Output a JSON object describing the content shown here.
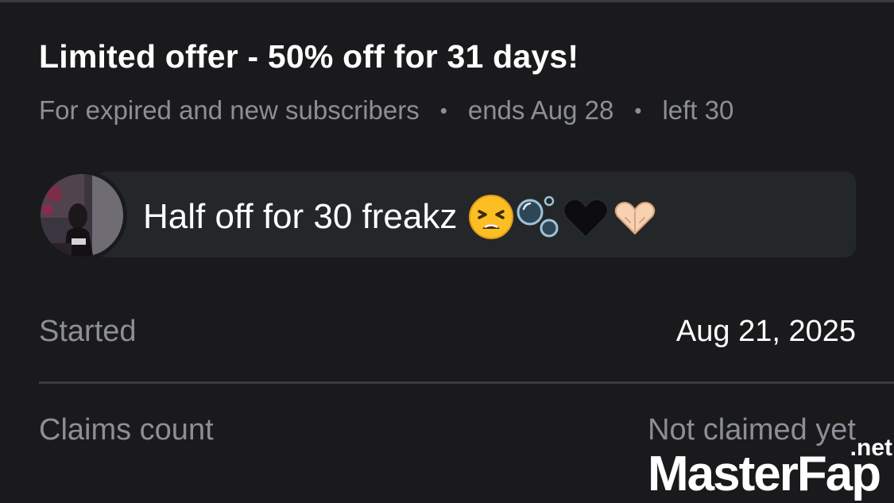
{
  "offer": {
    "title": "Limited offer - 50% off for 31 days!",
    "audience": "For expired and new subscribers",
    "separator": "•",
    "ends": "ends Aug 28",
    "left": "left 30"
  },
  "message": {
    "text": "Half off for 30 freakz",
    "emojis": [
      "tired-face-emoji",
      "bubbles-emoji",
      "black-heart-emoji",
      "heart-hands-emoji"
    ]
  },
  "details": {
    "started_label": "Started",
    "started_value": "Aug 21, 2025",
    "claims_label": "Claims count",
    "claims_value": "Not claimed yet"
  },
  "watermark": {
    "brand": "MasterFap",
    "tld": ".net"
  },
  "colors": {
    "background": "#1a1a1c",
    "bubble": "#24272a",
    "muted_text": "#8b8f96",
    "primary_text": "#ffffff",
    "divider": "#3a3b3f"
  }
}
